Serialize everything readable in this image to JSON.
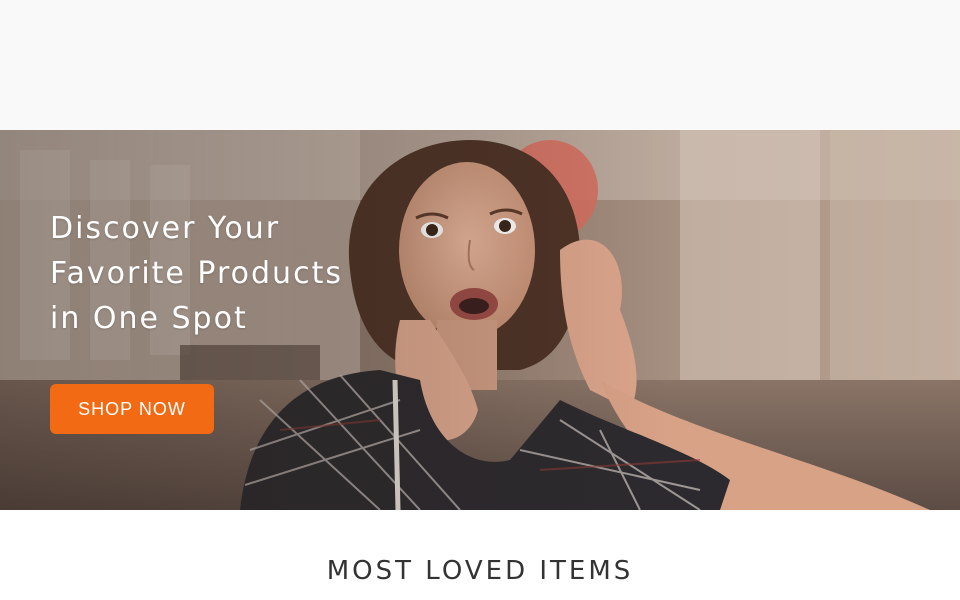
{
  "hero": {
    "heading": "Discover Your\nFavorite Products\nin One Spot",
    "button_label": "SHOP NOW",
    "image_description": "woman-surprised-street-photo"
  },
  "section": {
    "title": "MOST LOVED ITEMS"
  },
  "colors": {
    "header_bg": "#f9f9f9",
    "accent": "#f26a14",
    "hero_text": "#ffffff",
    "section_text": "#333333"
  }
}
